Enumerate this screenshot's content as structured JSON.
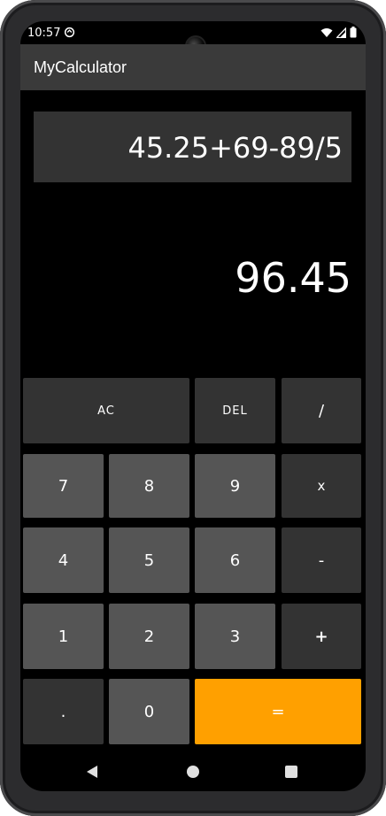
{
  "status_bar": {
    "time": "10:57",
    "icons": [
      "sync-icon",
      "wifi-icon",
      "signal-icon",
      "battery-icon"
    ]
  },
  "app_bar": {
    "title": "MyCalculator"
  },
  "display": {
    "expression": "45.25+69-89/5",
    "result": "96.45"
  },
  "keypad": {
    "ac": "AC",
    "del": "DEL",
    "divide": "/",
    "seven": "7",
    "eight": "8",
    "nine": "9",
    "multiply": "x",
    "four": "4",
    "five": "5",
    "six": "6",
    "minus": "-",
    "one": "1",
    "two": "2",
    "three": "3",
    "plus": "+",
    "dot": ".",
    "zero": "0",
    "equals": "="
  },
  "colors": {
    "accent": "#ffa000",
    "key_dark": "#333333",
    "key_light": "#555555",
    "app_bar": "#3a3a3a",
    "background": "#000000"
  },
  "nav_bar": {
    "icons": [
      "back-icon",
      "home-icon",
      "recents-icon"
    ]
  }
}
